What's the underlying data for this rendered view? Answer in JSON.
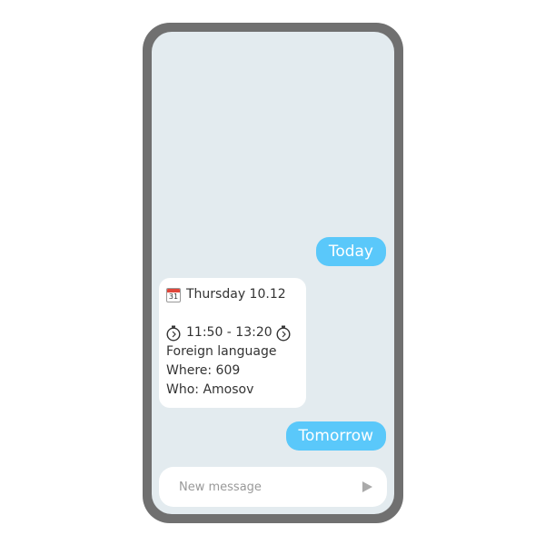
{
  "chat": {
    "messages": [
      {
        "from": "user",
        "text": "Today"
      },
      {
        "from": "bot",
        "date_line": "Thursday 10.12",
        "calendar_icon_day": "31",
        "time_line": "11:50 - 13:20",
        "subject": "Foreign language",
        "where": "Where: 609",
        "who": "Who: Amosov"
      },
      {
        "from": "user",
        "text": "Tomorrow"
      }
    ]
  },
  "composer": {
    "placeholder": "New message",
    "send_icon": "send-icon"
  },
  "colors": {
    "frame": "#707070",
    "screen_bg": "#e3ebef",
    "outgoing_bubble": "#5ac8fa",
    "incoming_bubble": "#ffffff"
  }
}
